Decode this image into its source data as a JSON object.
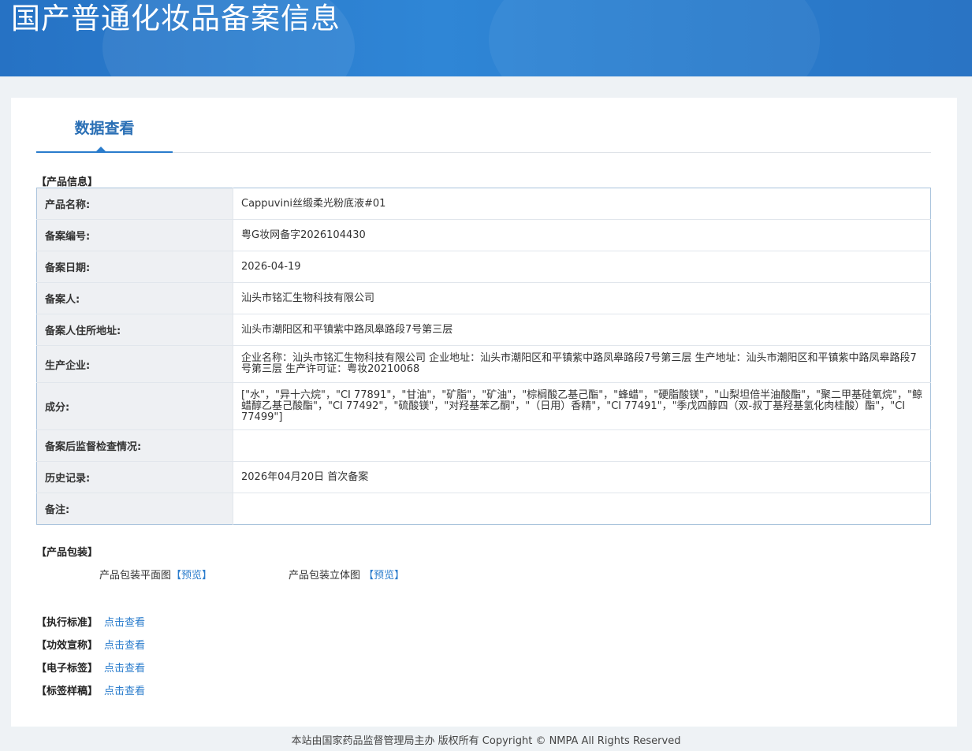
{
  "header": {
    "title": "国产普通化妆品备案信息"
  },
  "tab": {
    "label": "数据查看"
  },
  "product_info": {
    "section_title": "【产品信息】",
    "rows": [
      {
        "label": "产品名称:",
        "value": "Cappuvini丝缎柔光粉底液#01"
      },
      {
        "label": "备案编号:",
        "value": "粤G妆网备字2026104430"
      },
      {
        "label": "备案日期:",
        "value": "2026-04-19"
      },
      {
        "label": "备案人:",
        "value": "汕头市铭汇生物科技有限公司"
      },
      {
        "label": "备案人住所地址:",
        "value": "汕头市潮阳区和平镇紫中路凤皋路段7号第三层"
      },
      {
        "label": "生产企业:",
        "value": "企业名称：汕头市铭汇生物科技有限公司 企业地址：汕头市潮阳区和平镇紫中路凤皋路段7号第三层 生产地址：汕头市潮阳区和平镇紫中路凤皋路段7号第三层 生产许可证：粤妆20210068"
      },
      {
        "label": "成分:",
        "value": "[\"水\"，\"异十六烷\"，\"CI 77891\"，\"甘油\"，\"矿脂\"，\"矿油\"，\"棕榈酸乙基己酯\"，\"蜂蜡\"，\"硬脂酸镁\"，\"山梨坦倍半油酸酯\"，\"聚二甲基硅氧烷\"，\"鲸蜡醇乙基己酸酯\"，\"CI 77492\"，\"硫酸镁\"，\"对羟基苯乙酮\"，\"（日用）香精\"，\"CI 77491\"，\"季戊四醇四（双-叔丁基羟基氢化肉桂酸）酯\"，\"CI 77499\"]"
      },
      {
        "label": "备案后监督检查情况:",
        "value": ""
      },
      {
        "label": "历史记录:",
        "value": "2026年04月20日 首次备案"
      },
      {
        "label": "备注:",
        "value": ""
      }
    ]
  },
  "packaging": {
    "section_title": "【产品包装】",
    "flat_label": "产品包装平面图",
    "flat_link": "【预览】",
    "solid_label": "产品包装立体图",
    "solid_link": "【预览】"
  },
  "links": [
    {
      "label": "【执行标准】",
      "link": "点击查看"
    },
    {
      "label": "【功效宣称】",
      "link": "点击查看"
    },
    {
      "label": "【电子标签】",
      "link": "点击查看"
    },
    {
      "label": "【标签样稿】",
      "link": "点击查看"
    }
  ],
  "footer": {
    "text": "本站由国家药品监督管理局主办 版权所有 Copyright © NMPA All Rights Reserved"
  },
  "colors": {
    "banner": "#2a7ccc",
    "accent": "#2a6fb5",
    "label_bg": "#eef0f3"
  }
}
